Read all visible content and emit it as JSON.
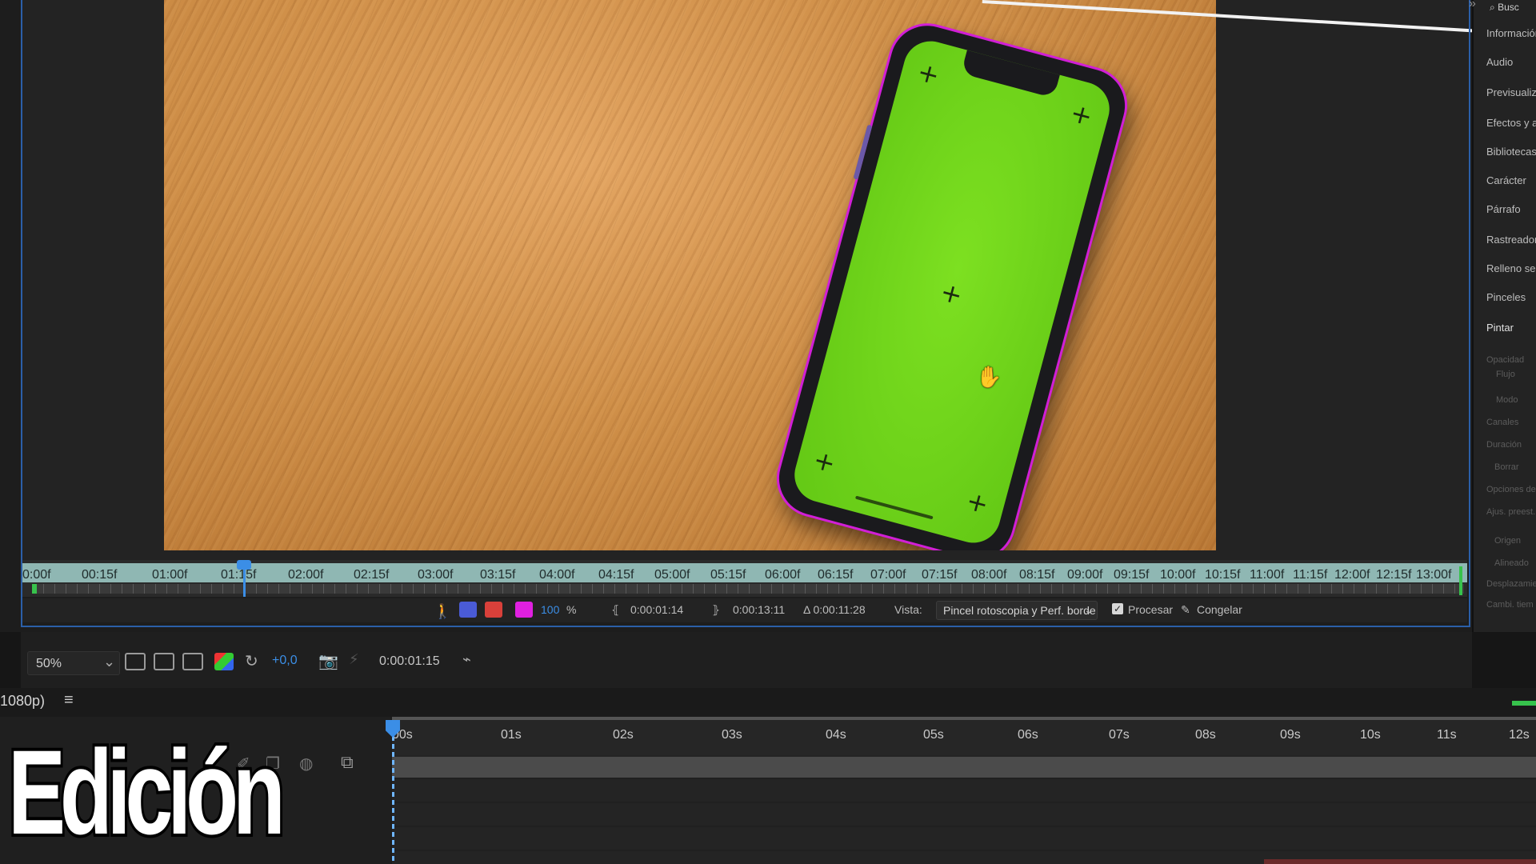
{
  "right_panel": {
    "search_label": "Busc",
    "items": [
      "Información",
      "Audio",
      "Previsualiza",
      "Efectos y ajus",
      "Bibliotecas",
      "Carácter",
      "Párrafo",
      "Rastreador",
      "Relleno segú",
      "Pinceles",
      "Pintar"
    ],
    "paint_settings": [
      "Opacidad",
      "Flujo",
      "Modo",
      "Canales",
      "Duración",
      "Borrar",
      "Opciones de",
      "Ajus. preest.",
      "Origen",
      "Alineado",
      "Desplazamie",
      "Cambi. tiem"
    ]
  },
  "mini_timeline": {
    "ticks": [
      "0:00f",
      "00:15f",
      "01:00f",
      "01:15f",
      "02:00f",
      "02:15f",
      "03:00f",
      "03:15f",
      "04:00f",
      "04:15f",
      "05:00f",
      "05:15f",
      "06:00f",
      "06:15f",
      "07:00f",
      "07:15f",
      "08:00f",
      "08:15f",
      "09:00f",
      "09:15f",
      "10:00f",
      "10:15f",
      "11:00f",
      "11:15f",
      "12:00f",
      "12:15f",
      "13:00f"
    ]
  },
  "controls": {
    "opacity_value": "100",
    "opacity_unit": "%",
    "in_time": "0:00:01:14",
    "out_time": "0:00:13:11",
    "duration": "Δ 0:00:11:28",
    "view_label": "Vista:",
    "view_value": "Pincel rotoscopia y Perf. borde",
    "process_label": "Procesar",
    "freeze_label": "Congelar",
    "swatch_colors": [
      "#4a5bd6",
      "#d9403a",
      "#e020e0"
    ]
  },
  "viewer_toolbar": {
    "zoom": "50%",
    "exposure": "+0,0",
    "current_time": "0:00:01:15"
  },
  "timeline": {
    "comp_label": "1080p)",
    "ticks": [
      "00s",
      "01s",
      "02s",
      "03s",
      "04s",
      "05s",
      "06s",
      "07s",
      "08s",
      "09s",
      "10s",
      "11s",
      "12s"
    ]
  },
  "overlay_title": "Edición"
}
